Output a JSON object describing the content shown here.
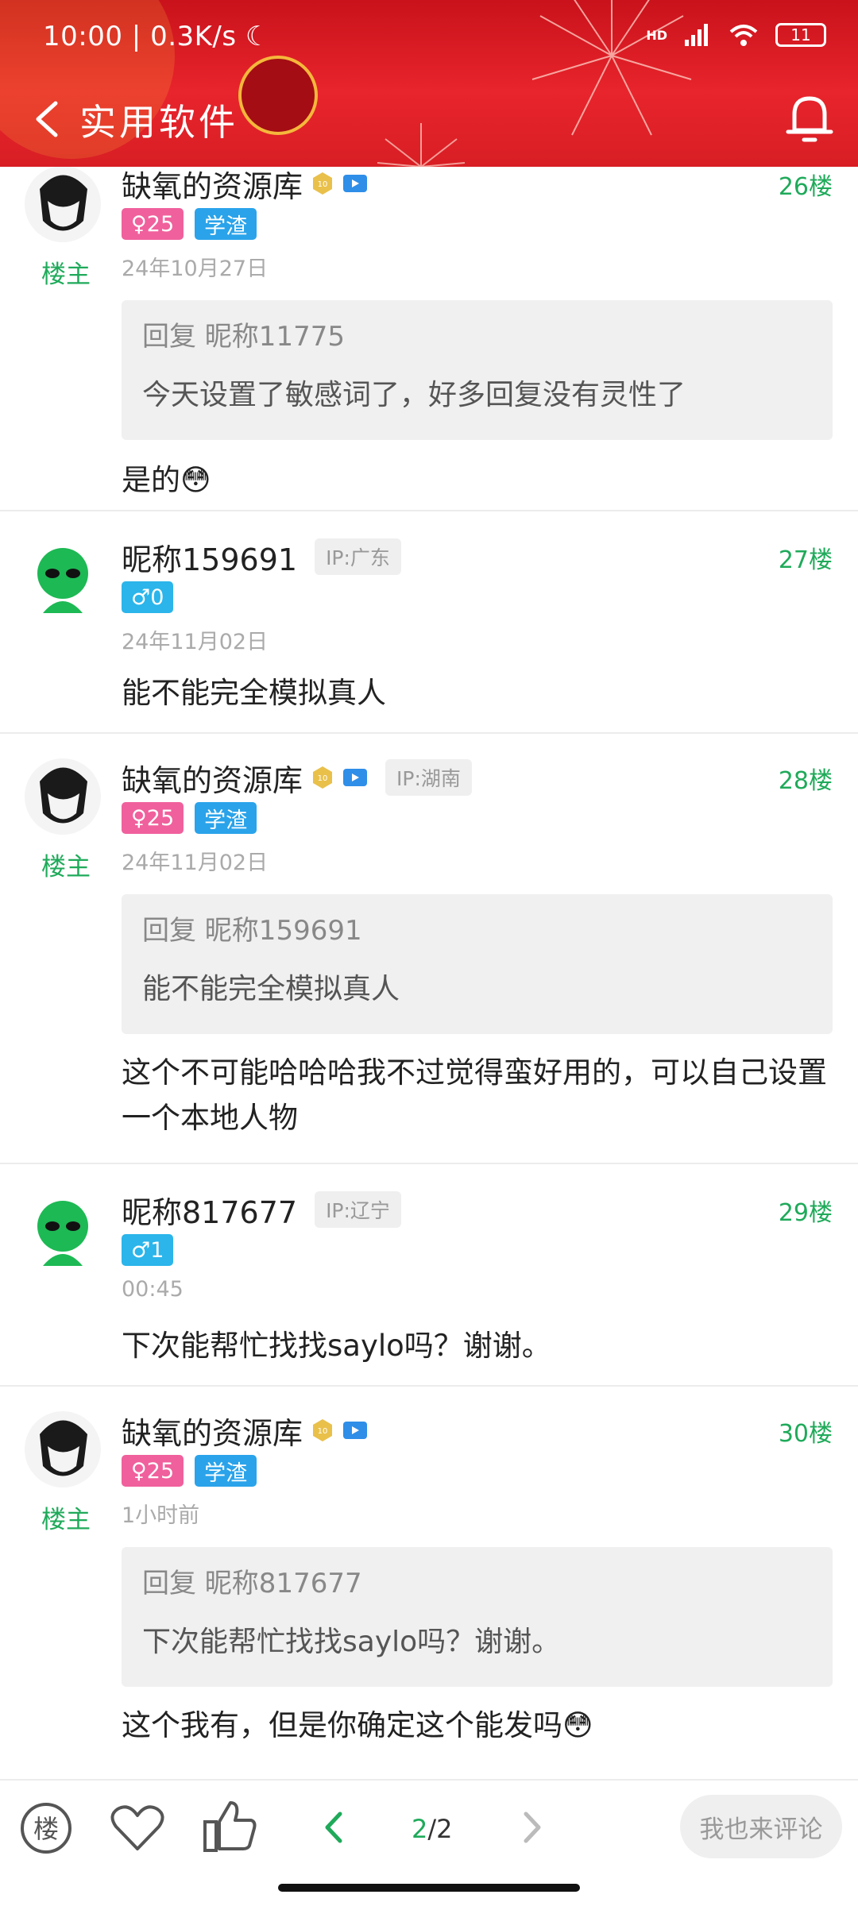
{
  "colors": {
    "accent_green": "#1faa5a",
    "header_red": "#e8242c",
    "female_badge": "#f0609c",
    "male_badge": "#2bb5ea"
  },
  "status_bar": {
    "time": "10:00",
    "speed": "0.3K/s",
    "battery": "11",
    "network": "HD"
  },
  "header": {
    "back_icon": "chevron-left-icon",
    "title": "实用软件",
    "bell_icon": "bell-icon"
  },
  "posts": [
    {
      "name": "缺氧的资源库",
      "owner_label": "楼主",
      "floor": "26楼",
      "gender": "♀25",
      "tag": "学渣",
      "date": "24年10月27日",
      "quote_head": "回复 昵称11775",
      "quote_text": "今天设置了敏感词了，好多回复没有灵性了",
      "text": "是的"
    },
    {
      "name": "昵称159691",
      "ip": "IP:广东",
      "floor": "27楼",
      "gender": "♂0",
      "date": "24年11月02日",
      "text": "能不能完全模拟真人"
    },
    {
      "name": "缺氧的资源库",
      "owner_label": "楼主",
      "ip": "IP:湖南",
      "floor": "28楼",
      "gender": "♀25",
      "tag": "学渣",
      "date": "24年11月02日",
      "quote_head": "回复 昵称159691",
      "quote_text": "能不能完全模拟真人",
      "text": "这个不可能哈哈哈我不过觉得蛮好用的，可以自己设置一个本地人物"
    },
    {
      "name": "昵称817677",
      "ip": "IP:辽宁",
      "floor": "29楼",
      "gender": "♂1",
      "date": "00:45",
      "text": "下次能帮忙找找saylo吗？谢谢。"
    },
    {
      "name": "缺氧的资源库",
      "owner_label": "楼主",
      "floor": "30楼",
      "gender": "♀25",
      "tag": "学渣",
      "date": "1小时前",
      "quote_head": "回复 昵称817677",
      "quote_text": "下次能帮忙找找saylo吗？谢谢。",
      "text": "这个我有，但是你确定这个能发吗"
    }
  ],
  "bottom_bar": {
    "floor_icon_label": "楼",
    "page_current": "2",
    "page_total": "/2",
    "comment_placeholder": "我也来评论"
  }
}
